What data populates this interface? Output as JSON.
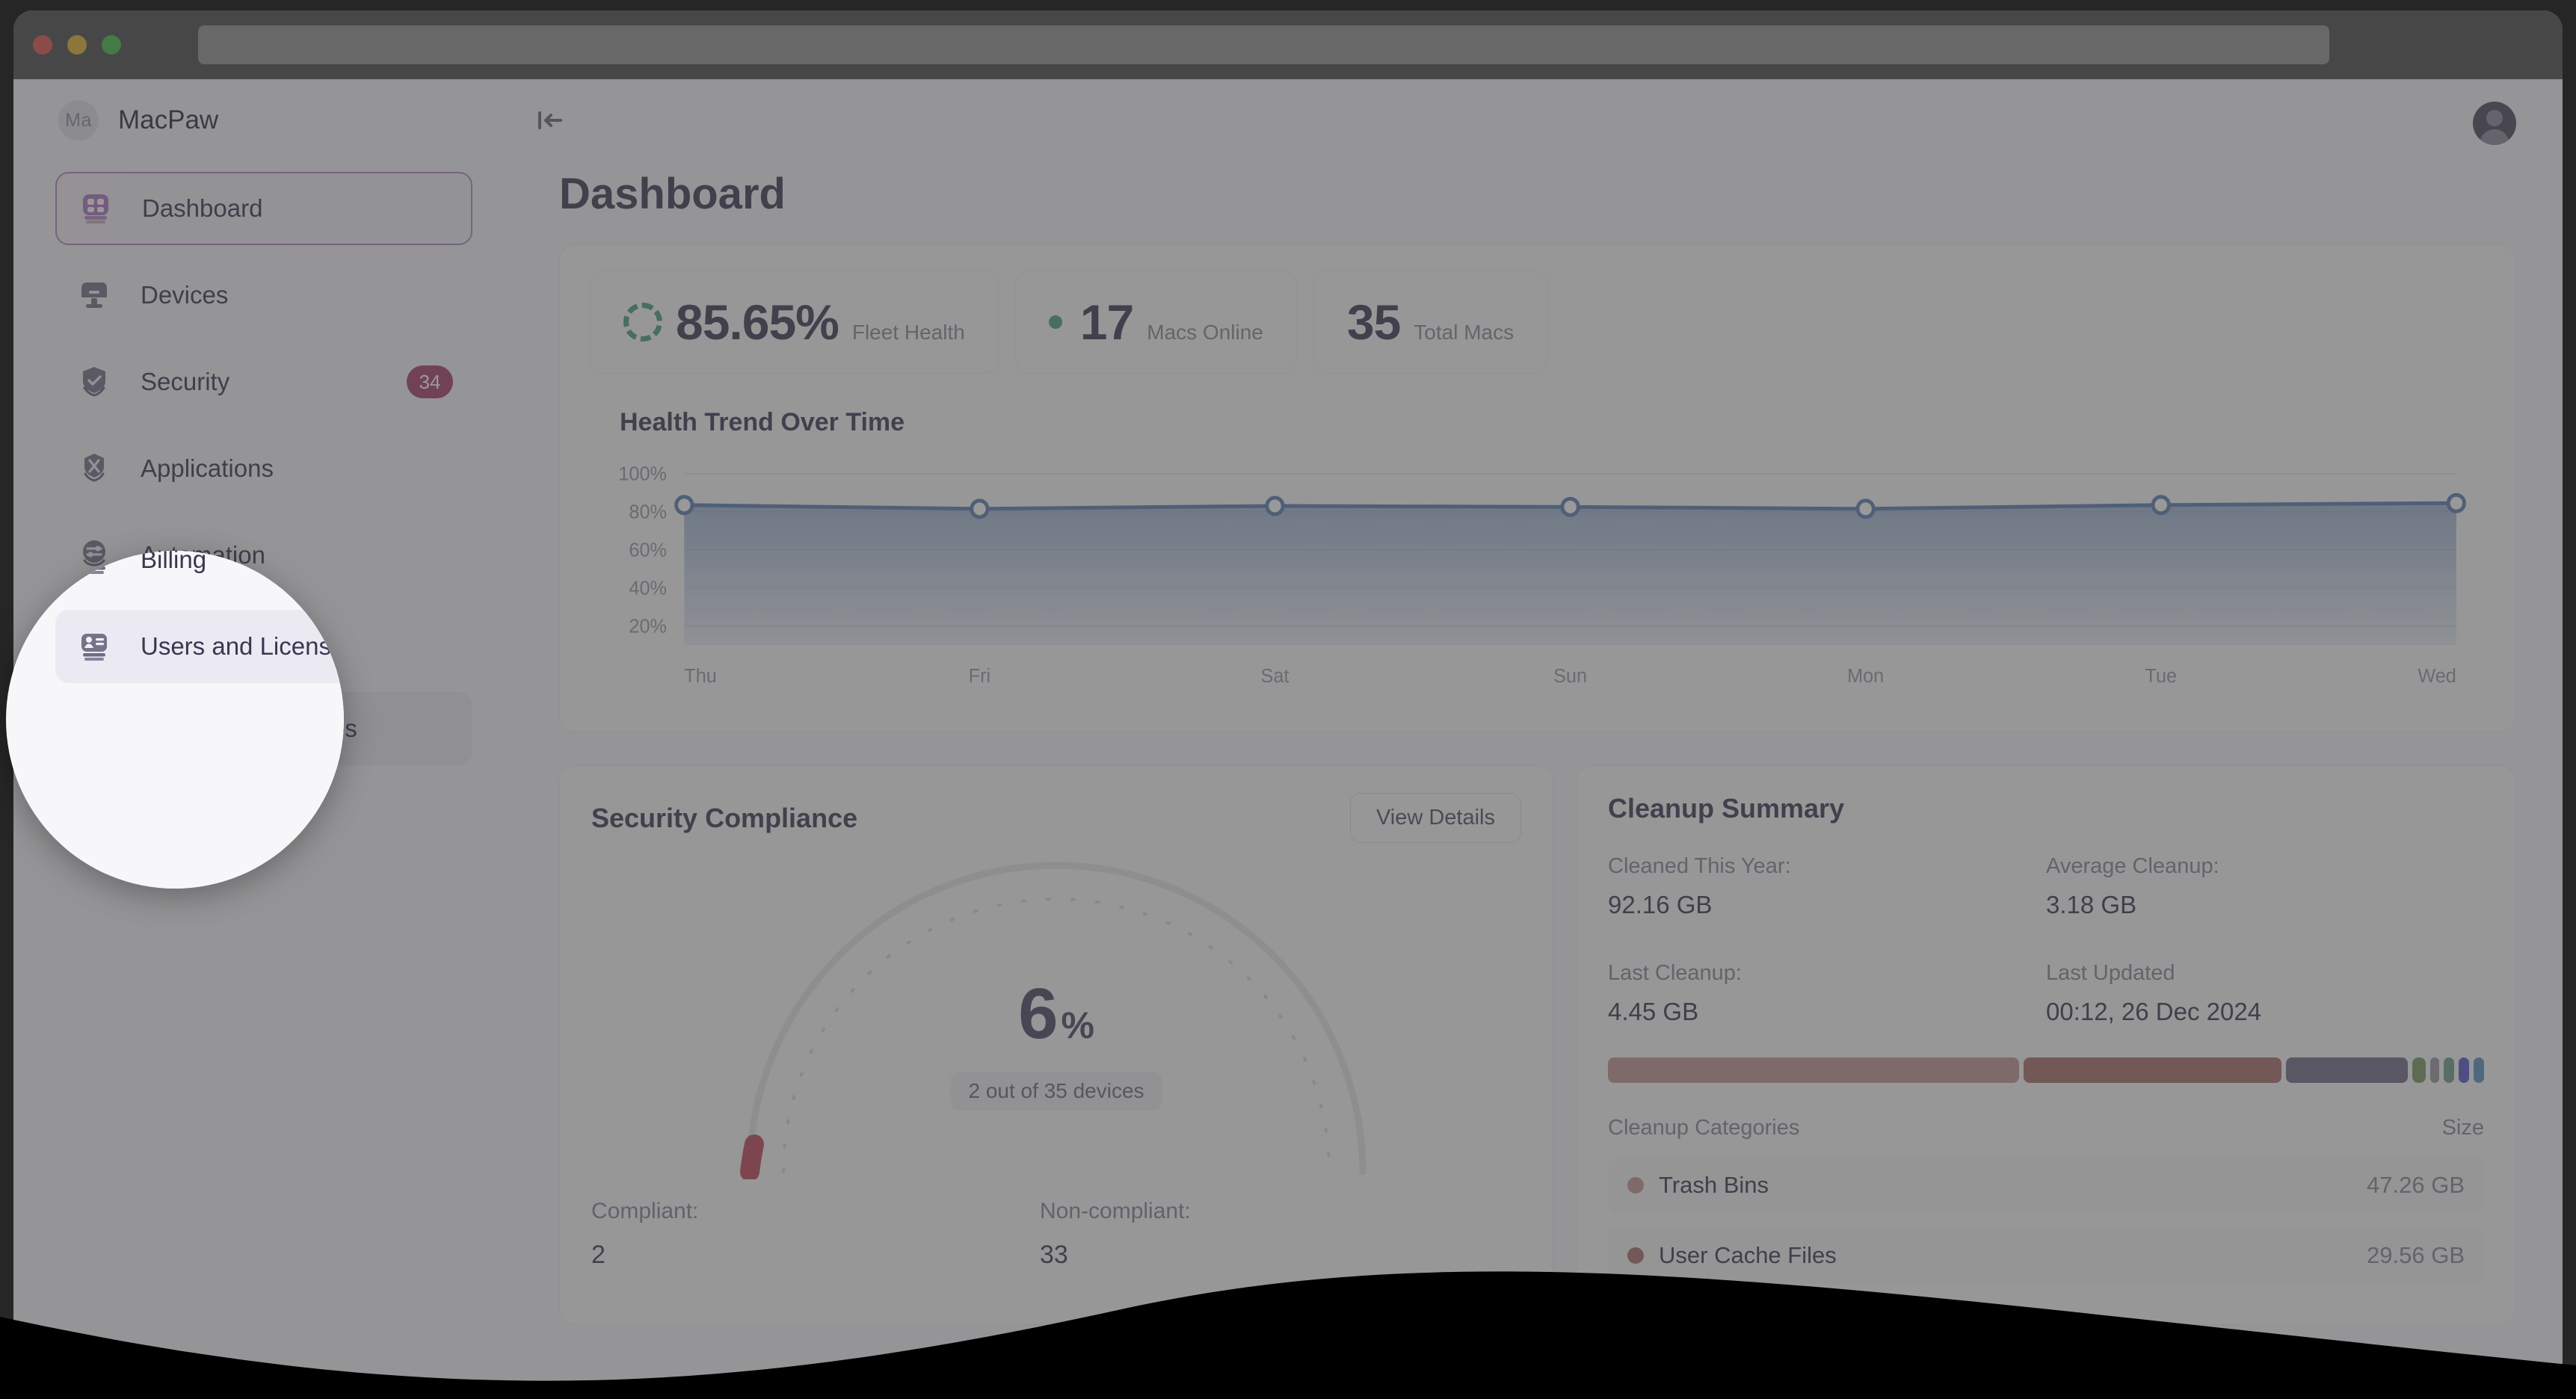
{
  "window": {
    "traffic_lights": [
      "close",
      "minimize",
      "zoom"
    ],
    "url_value": ""
  },
  "sidebar": {
    "brand_initials": "Ma",
    "brand_name": "MacPaw",
    "items": [
      {
        "label": "Dashboard",
        "icon": "dashboard-icon",
        "state": "active",
        "badge": ""
      },
      {
        "label": "Devices",
        "icon": "monitor-icon",
        "state": "default",
        "badge": ""
      },
      {
        "label": "Security",
        "icon": "shield-icon",
        "state": "default",
        "badge": "34"
      },
      {
        "label": "Applications",
        "icon": "apps-icon",
        "state": "default",
        "badge": ""
      },
      {
        "label": "Automation",
        "icon": "sliders-icon",
        "state": "default",
        "badge": ""
      },
      {
        "label": "Billing",
        "icon": "card-icon",
        "state": "default",
        "badge": ""
      },
      {
        "label": "Users and Licenses",
        "icon": "user-card-icon",
        "state": "selected",
        "badge": ""
      }
    ]
  },
  "topbar": {
    "collapse_icon": "collapse-sidebar-icon",
    "avatar_icon": "user-avatar-icon"
  },
  "page": {
    "title": "Dashboard"
  },
  "kpis": [
    {
      "value": "85.65%",
      "label": "Fleet Health",
      "icon": "donut-progress-icon"
    },
    {
      "value": "17",
      "label": "Macs Online",
      "icon": "status-dot-icon"
    },
    {
      "value": "35",
      "label": "Total Macs",
      "icon": ""
    }
  ],
  "security_card": {
    "title": "Security Compliance",
    "view_details_label": "View Details",
    "gauge_value": "6",
    "gauge_unit": "%",
    "gauge_sub": "2 out of 35 devices",
    "compliant_label": "Compliant:",
    "compliant_value": "2",
    "noncompliant_label": "Non-compliant:",
    "noncompliant_value": "33"
  },
  "cleanup_card": {
    "title": "Cleanup Summary",
    "stats": [
      {
        "label": "Cleaned This Year:",
        "value": "92.16 GB"
      },
      {
        "label": "Average Cleanup:",
        "value": "3.18 GB"
      },
      {
        "label": "Last Cleanup:",
        "value": "4.45 GB"
      },
      {
        "label": "Last Updated",
        "value": "00:12, 26 Dec 2024"
      }
    ],
    "segments": [
      {
        "flex": 47.26,
        "color": "#c39a96"
      },
      {
        "flex": 29.56,
        "color": "#a8706c"
      },
      {
        "flex": 14.0,
        "color": "#736d8a"
      },
      {
        "flex": 1.6,
        "color": "#7a9a63"
      },
      {
        "flex": 1.0,
        "color": "#9a9aa4"
      },
      {
        "flex": 1.2,
        "color": "#6f9e8e"
      },
      {
        "flex": 1.2,
        "color": "#5a5ad0"
      },
      {
        "flex": 1.2,
        "color": "#5e93c4"
      }
    ],
    "col_category": "Cleanup Categories",
    "col_size": "Size",
    "rows": [
      {
        "name": "Trash Bins",
        "size": "47.26 GB",
        "color": "#c39a96"
      },
      {
        "name": "User Cache Files",
        "size": "29.56 GB",
        "color": "#a8706c"
      }
    ]
  },
  "chart_data": {
    "type": "area",
    "title": "Health Trend Over Time",
    "x": [
      "Thu",
      "Fri",
      "Sat",
      "Sun",
      "Mon",
      "Tue",
      "Wed"
    ],
    "values": [
      83.5,
      81.5,
      83.0,
      82.5,
      81.5,
      83.5,
      84.5
    ],
    "ylabel": "",
    "xlabel": "",
    "ylim": [
      10,
      105
    ],
    "yticks": [
      "20%",
      "40%",
      "60%",
      "80%",
      "100%"
    ],
    "ytick_values": [
      20,
      40,
      60,
      80,
      100
    ],
    "grid": true,
    "legend": "none",
    "line_color": "#5b7fb5",
    "marker": "open-circle"
  },
  "colors": {
    "accent_purple": "#b487c9",
    "badge_pink": "#a63f69",
    "green": "#4f9f7f",
    "chart_blue": "#5b7fb5",
    "text_dark": "#3e3b54",
    "text_muted": "#8a8899"
  }
}
